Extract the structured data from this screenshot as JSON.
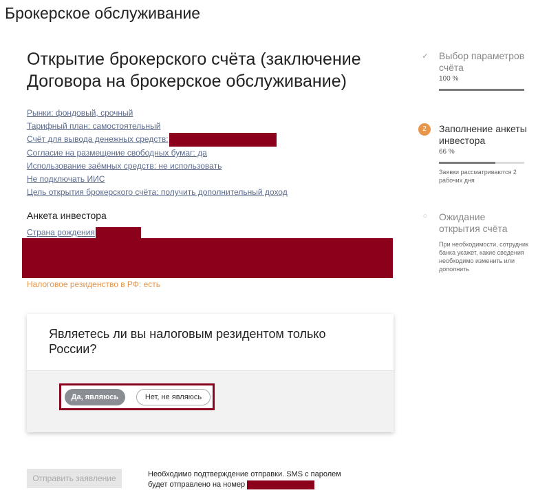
{
  "page_title": "Брокерское обслуживание",
  "main_heading": "Открытие брокерского счёта (заключение Договора на брокерское обслуживание)",
  "params": [
    "Рынки: фондовый, срочный",
    "Тарифный план: самостоятельный",
    "Счёт для вывода денежных средств:",
    "Согласие на размещение свободных бумаг: да",
    "Использование заёмных средств: не использовать",
    "Не подключать ИИС",
    "Цель открытия брокерского счёта: получить дополнительный доход"
  ],
  "questionnaire": {
    "title": "Анкета инвестора",
    "country_label": "Страна рождения",
    "tax_residency": "Налоговое резиденство в РФ: есть"
  },
  "card": {
    "question": "Являетесь ли вы налоговым резидентом только России?",
    "yes_label": "Да, являюсь",
    "no_label": "Нет, не являюсь"
  },
  "submit": {
    "label": "Отправить заявление",
    "note": "Необходимо подтверждение отправки. SMS с паролем будет отправлено на номер"
  },
  "steps": [
    {
      "mark": "✓",
      "title": "Выбор параметров счёта",
      "percent": "100 %",
      "progress": 1.0,
      "note": ""
    },
    {
      "mark": "2",
      "title": "Заполнение анкеты инвестора",
      "percent": "66 %",
      "progress": 0.66,
      "note": "Заявки рассматриваются 2 рабочих дня"
    },
    {
      "mark": "○",
      "title": "Ожидание открытия счёта",
      "percent": "",
      "progress": null,
      "note": "При необходимости, сотрудник банка укажет, какие сведения необходимо изменить или дополнить"
    }
  ],
  "colors": {
    "accent": "#e8964a",
    "redaction": "#8b001b",
    "link": "#5b6b8c"
  }
}
